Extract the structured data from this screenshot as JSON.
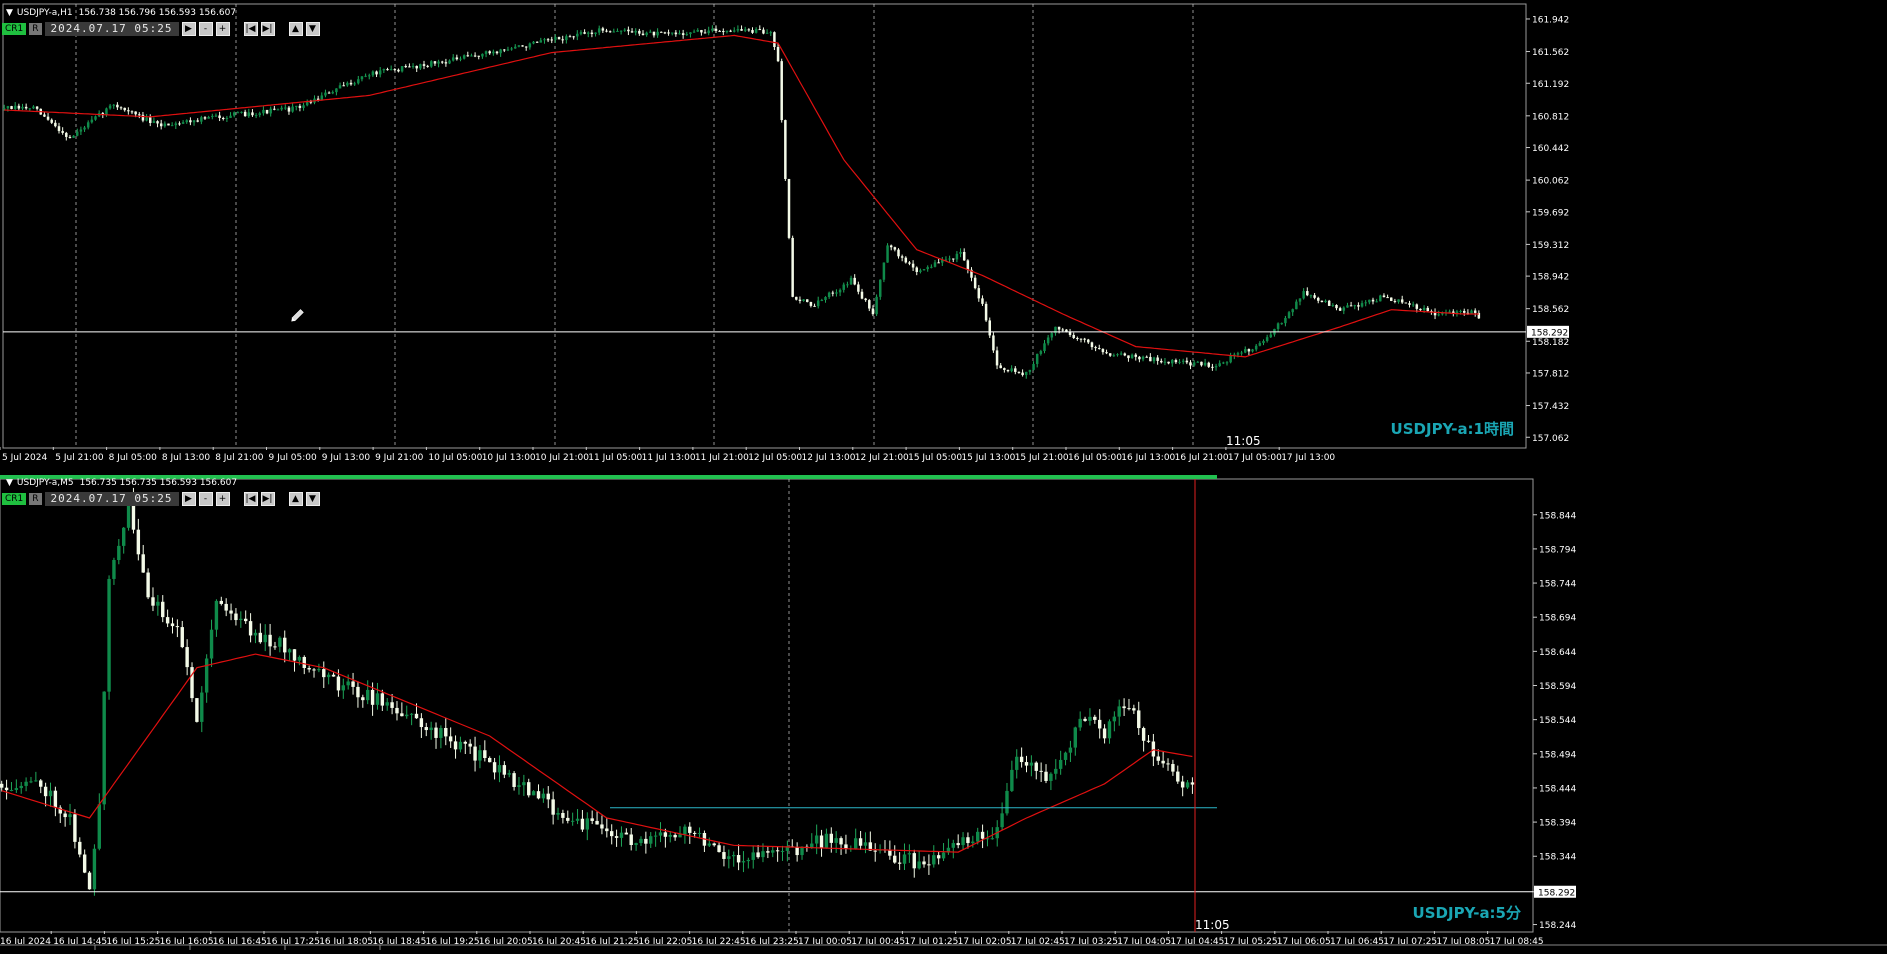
{
  "colors": {
    "background": "#000000",
    "bull_body": "#0f8a4a",
    "bear_body": "#f4fbe8",
    "wick": "#1fa85a",
    "ma": "#e01010",
    "grid": "#cfcfcf",
    "axis_text": "#ffffff",
    "price_line": "#ffffff",
    "hline": "#2bb6c8",
    "vline_red": "#e02020",
    "watermark": "#1aa6b4",
    "active_bar": "#22c050"
  },
  "icons": [
    "pencil-icon",
    "play-icon",
    "minus-icon",
    "plus-icon",
    "first-bar-icon",
    "last-bar-icon",
    "up-icon",
    "down-icon"
  ],
  "charts": [
    {
      "symbol_header": "USDJPY-a,H1",
      "ohlc_header": "156.738 156.796 156.593 156.607",
      "badge": "CR1",
      "badge_r": "R",
      "date_field": "2024.07.17  05:25",
      "watermark": "USDJPY-a:1時間",
      "time_marker": "11:05",
      "current_price_label": "158.292",
      "price_ticks": [
        "161.942",
        "161.562",
        "161.192",
        "160.812",
        "160.442",
        "160.062",
        "159.692",
        "159.312",
        "158.942",
        "158.562",
        "158.182",
        "157.812",
        "157.432",
        "157.062"
      ],
      "time_ticks": [
        "5 Jul 2024",
        "5 Jul 21:00",
        "8 Jul 05:00",
        "8 Jul 13:00",
        "8 Jul 21:00",
        "9 Jul 05:00",
        "9 Jul 13:00",
        "9 Jul 21:00",
        "10 Jul 05:00",
        "10 Jul 13:00",
        "10 Jul 21:00",
        "11 Jul 05:00",
        "11 Jul 13:00",
        "11 Jul 21:00",
        "12 Jul 05:00",
        "12 Jul 13:00",
        "12 Jul 21:00",
        "15 Jul 05:00",
        "15 Jul 13:00",
        "15 Jul 21:00",
        "16 Jul 05:00",
        "16 Jul 13:00",
        "16 Jul 21:00",
        "17 Jul 05:00",
        "17 Jul 13:00"
      ]
    },
    {
      "symbol_header": "USDJPY-a,M5",
      "ohlc_header": "156.735 156.735 156.593 156.607",
      "badge": "CR1",
      "badge_r": "R",
      "date_field": "2024.07.17  05:25",
      "watermark": "USDJPY-a:5分",
      "time_marker": "11:05",
      "current_price_label": "158.292",
      "price_ticks": [
        "158.844",
        "158.794",
        "158.744",
        "158.694",
        "158.644",
        "158.594",
        "158.544",
        "158.494",
        "158.444",
        "158.394",
        "158.344",
        "158.292",
        "158.244"
      ],
      "time_ticks": [
        "16 Jul 2024",
        "16 Jul 14:45",
        "16 Jul 15:25",
        "16 Jul 16:05",
        "16 Jul 16:45",
        "16 Jul 17:25",
        "16 Jul 18:05",
        "16 Jul 18:45",
        "16 Jul 19:25",
        "16 Jul 20:05",
        "16 Jul 20:45",
        "16 Jul 21:25",
        "16 Jul 22:05",
        "16 Jul 22:45",
        "16 Jul 23:25",
        "17 Jul 00:05",
        "17 Jul 00:45",
        "17 Jul 01:25",
        "17 Jul 02:05",
        "17 Jul 02:45",
        "17 Jul 03:25",
        "17 Jul 04:05",
        "17 Jul 04:45",
        "17 Jul 05:25",
        "17 Jul 06:05",
        "17 Jul 06:45",
        "17 Jul 07:25",
        "17 Jul 08:05",
        "17 Jul 08:45"
      ]
    }
  ],
  "chart_data": [
    {
      "type": "candlestick",
      "series_kind": "ohlc with moving average",
      "ylim": [
        156.96,
        162.0
      ],
      "current_price": 158.292,
      "anchors": [
        [
          0,
          160.9
        ],
        [
          8,
          160.9
        ],
        [
          18,
          160.55
        ],
        [
          30,
          160.95
        ],
        [
          42,
          160.7
        ],
        [
          58,
          160.8
        ],
        [
          80,
          160.9
        ],
        [
          100,
          161.3
        ],
        [
          125,
          161.48
        ],
        [
          145,
          161.65
        ],
        [
          165,
          161.82
        ],
        [
          180,
          161.76
        ],
        [
          200,
          161.82
        ],
        [
          210,
          161.78
        ],
        [
          212,
          161.45
        ],
        [
          216,
          158.7
        ],
        [
          222,
          158.6
        ],
        [
          232,
          158.9
        ],
        [
          238,
          158.5
        ],
        [
          242,
          159.3
        ],
        [
          250,
          159.0
        ],
        [
          262,
          159.2
        ],
        [
          268,
          158.6
        ],
        [
          272,
          157.9
        ],
        [
          280,
          157.8
        ],
        [
          288,
          158.35
        ],
        [
          302,
          158.05
        ],
        [
          318,
          157.95
        ],
        [
          332,
          157.9
        ],
        [
          346,
          158.2
        ],
        [
          356,
          158.75
        ],
        [
          366,
          158.55
        ],
        [
          378,
          158.7
        ],
        [
          392,
          158.5
        ],
        [
          402,
          158.52
        ],
        [
          405,
          158.45
        ]
      ],
      "ma_anchors": [
        [
          0,
          160.88
        ],
        [
          40,
          160.8
        ],
        [
          100,
          161.05
        ],
        [
          150,
          161.55
        ],
        [
          200,
          161.75
        ],
        [
          212,
          161.66
        ],
        [
          230,
          160.3
        ],
        [
          250,
          159.25
        ],
        [
          268,
          158.95
        ],
        [
          290,
          158.5
        ],
        [
          310,
          158.12
        ],
        [
          340,
          158.0
        ],
        [
          366,
          158.35
        ],
        [
          380,
          158.55
        ],
        [
          400,
          158.5
        ]
      ],
      "bars": 405
    },
    {
      "type": "candlestick",
      "series_kind": "ohlc with moving average",
      "ylim": [
        158.236,
        158.87
      ],
      "current_price": 158.292,
      "support_level": 158.415,
      "anchors": [
        [
          0,
          158.45
        ],
        [
          8,
          158.45
        ],
        [
          14,
          158.4
        ],
        [
          18,
          158.29
        ],
        [
          20,
          158.42
        ],
        [
          22,
          158.75
        ],
        [
          26,
          158.86
        ],
        [
          30,
          158.72
        ],
        [
          36,
          158.68
        ],
        [
          40,
          158.55
        ],
        [
          44,
          158.72
        ],
        [
          52,
          158.67
        ],
        [
          58,
          158.65
        ],
        [
          68,
          158.6
        ],
        [
          78,
          158.57
        ],
        [
          88,
          158.53
        ],
        [
          98,
          158.49
        ],
        [
          108,
          158.44
        ],
        [
          116,
          158.4
        ],
        [
          124,
          158.38
        ],
        [
          132,
          158.36
        ],
        [
          140,
          158.39
        ],
        [
          150,
          158.34
        ],
        [
          160,
          158.35
        ],
        [
          170,
          158.37
        ],
        [
          180,
          158.35
        ],
        [
          190,
          158.33
        ],
        [
          198,
          158.37
        ],
        [
          204,
          158.38
        ],
        [
          208,
          158.5
        ],
        [
          214,
          158.45
        ],
        [
          222,
          158.55
        ],
        [
          226,
          158.52
        ],
        [
          230,
          158.57
        ],
        [
          236,
          158.5
        ],
        [
          240,
          158.46
        ],
        [
          244,
          158.44
        ]
      ],
      "ma_anchors": [
        [
          0,
          158.44
        ],
        [
          18,
          158.4
        ],
        [
          40,
          158.62
        ],
        [
          52,
          158.64
        ],
        [
          66,
          158.62
        ],
        [
          100,
          158.52
        ],
        [
          124,
          158.4
        ],
        [
          150,
          158.36
        ],
        [
          196,
          158.35
        ],
        [
          210,
          158.4
        ],
        [
          226,
          158.45
        ],
        [
          236,
          158.5
        ],
        [
          244,
          158.49
        ]
      ],
      "bars": 245
    }
  ]
}
